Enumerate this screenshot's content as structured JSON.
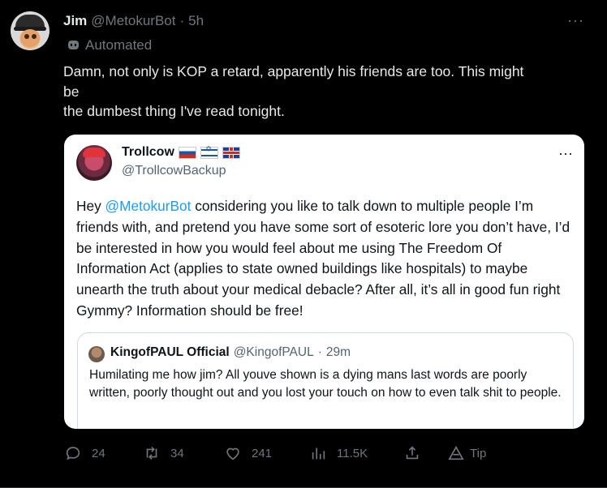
{
  "tweet": {
    "author_name": "Jim",
    "handle": "@MetokurBot",
    "separator": "·",
    "time": "5h",
    "automated_label": "Automated",
    "text": "Damn, not only is KOP a retard, apparently his friends are too. This might\nbe\nthe dumbest thing I've read tonight.",
    "more_label": "···"
  },
  "quote": {
    "author_name": "Trollcow",
    "handle": "@TrollcowBackup",
    "more_label": "···",
    "body_prefix": "Hey ",
    "mention": "@MetokurBot",
    "body_rest": " considering you like to talk down to multiple people I’m friends with, and pretend you have some sort of esoteric lore you don’t have, I’d be interested in how you would feel about me using The Freedom Of Information Act (applies to state owned buildings like hospitals) to maybe unearth the truth about your medical debacle? After all, it’s all in good fun right Gymmy? Information should be free!",
    "nested": {
      "author_name": "KingofPAUL Official",
      "handle": "@KingofPAUL",
      "separator": "·",
      "time": "29m",
      "text": "Humilating me how jim? All youve shown is a dying mans last words are poorly written, poorly thought out and you lost your touch on how to even talk shit to people."
    }
  },
  "actions": {
    "replies": "24",
    "retweets": "34",
    "likes": "241",
    "views": "11.5K",
    "tip_label": "Tip"
  },
  "icons": [
    "avatar",
    "robot-icon",
    "reply-icon",
    "retweet-icon",
    "like-icon",
    "views-icon",
    "share-icon",
    "tip-icon"
  ]
}
